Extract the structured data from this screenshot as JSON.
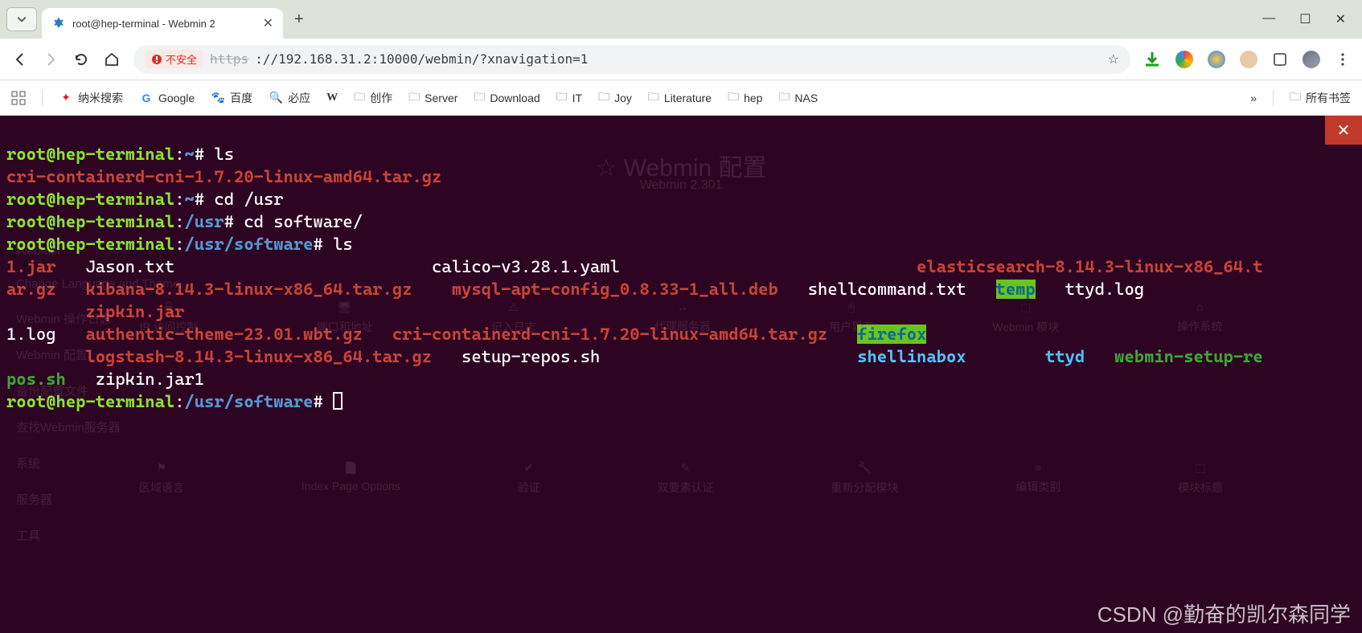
{
  "window": {
    "tab_title": "root@hep-terminal - Webmin 2",
    "win_min": "—",
    "win_max": "☐",
    "win_close": "✕"
  },
  "toolbar": {
    "insecure_label": "不安全",
    "url_proto": "https",
    "url_rest": "://192.168.31.2:10000/webmin/?xnavigation=1"
  },
  "bookmarks": {
    "b1": "纳米搜索",
    "b2": "Google",
    "b3": "百度",
    "b4": "必应",
    "b5": "W",
    "f1": "创作",
    "f2": "Server",
    "f3": "Download",
    "f4": "IT",
    "f5": "Joy",
    "f6": "Literature",
    "f7": "hep",
    "f8": "NAS",
    "overflow": "»",
    "all": "所有书签"
  },
  "bg": {
    "title": "☆ Webmin 配置",
    "sub": "Webmin 2.301",
    "side": [
      "Webmin",
      "Change Language and Theme",
      "Webmin 操作日志",
      "Webmin 配置",
      "备份配置文件",
      "查找Webmin服务器",
      "系统",
      "服务器",
      "工具"
    ],
    "row1": [
      "IP 访问控制",
      "端口和地址",
      "记入日志",
      "代理服务器",
      "用户界面",
      "Webmin 模块",
      "操作系统"
    ],
    "row2": [
      "区域语言",
      "Index Page Options",
      "验证",
      "双要素认证",
      "重新分配模块",
      "编辑类别",
      "模块标题"
    ]
  },
  "terminal": {
    "prompt_user": "root@hep-terminal",
    "home": "~",
    "usr": "/usr",
    "sw": "/usr/software",
    "cmd_ls": "ls",
    "cmd_cd_usr": "cd /usr",
    "cmd_cd_sw": "cd software/",
    "file_cri": "cri-containerd-cni-1.7.20-linux-amd64.tar.gz",
    "f_1jar": "1.jar",
    "f_jason": "Jason.txt",
    "f_calico": "calico-v3.28.1.yaml",
    "f_elastic": "elasticsearch-8.14.3-linux-x86_64.t",
    "f_argz": "ar.gz",
    "f_kibana": "kibana-8.14.3-linux-x86_64.tar.gz",
    "f_mysql": "mysql-apt-config_0.8.33-1_all.deb",
    "f_shellcmd": "shellcommand.txt",
    "f_temp": "temp",
    "f_ttydlog": "ttyd.log",
    "f_zipkin": "zipkin.jar",
    "f_1log": "1.log",
    "f_auth": "authentic-theme-23.01.wbt.gz",
    "f_cri2": "cri-containerd-cni-1.7.20-linux-amd64.tar.gz",
    "f_firefox": "firefox",
    "f_logstash": "logstash-8.14.3-linux-x86_64.tar.gz",
    "f_setup": "setup-repos.sh",
    "f_shbox": "shellinabox",
    "f_ttyd": "ttyd",
    "f_wsetup": "webmin-setup-re",
    "f_pos": "pos.sh",
    "f_zip1": "zipkin.jar1"
  },
  "watermark": "CSDN @勤奋的凯尔森同学"
}
